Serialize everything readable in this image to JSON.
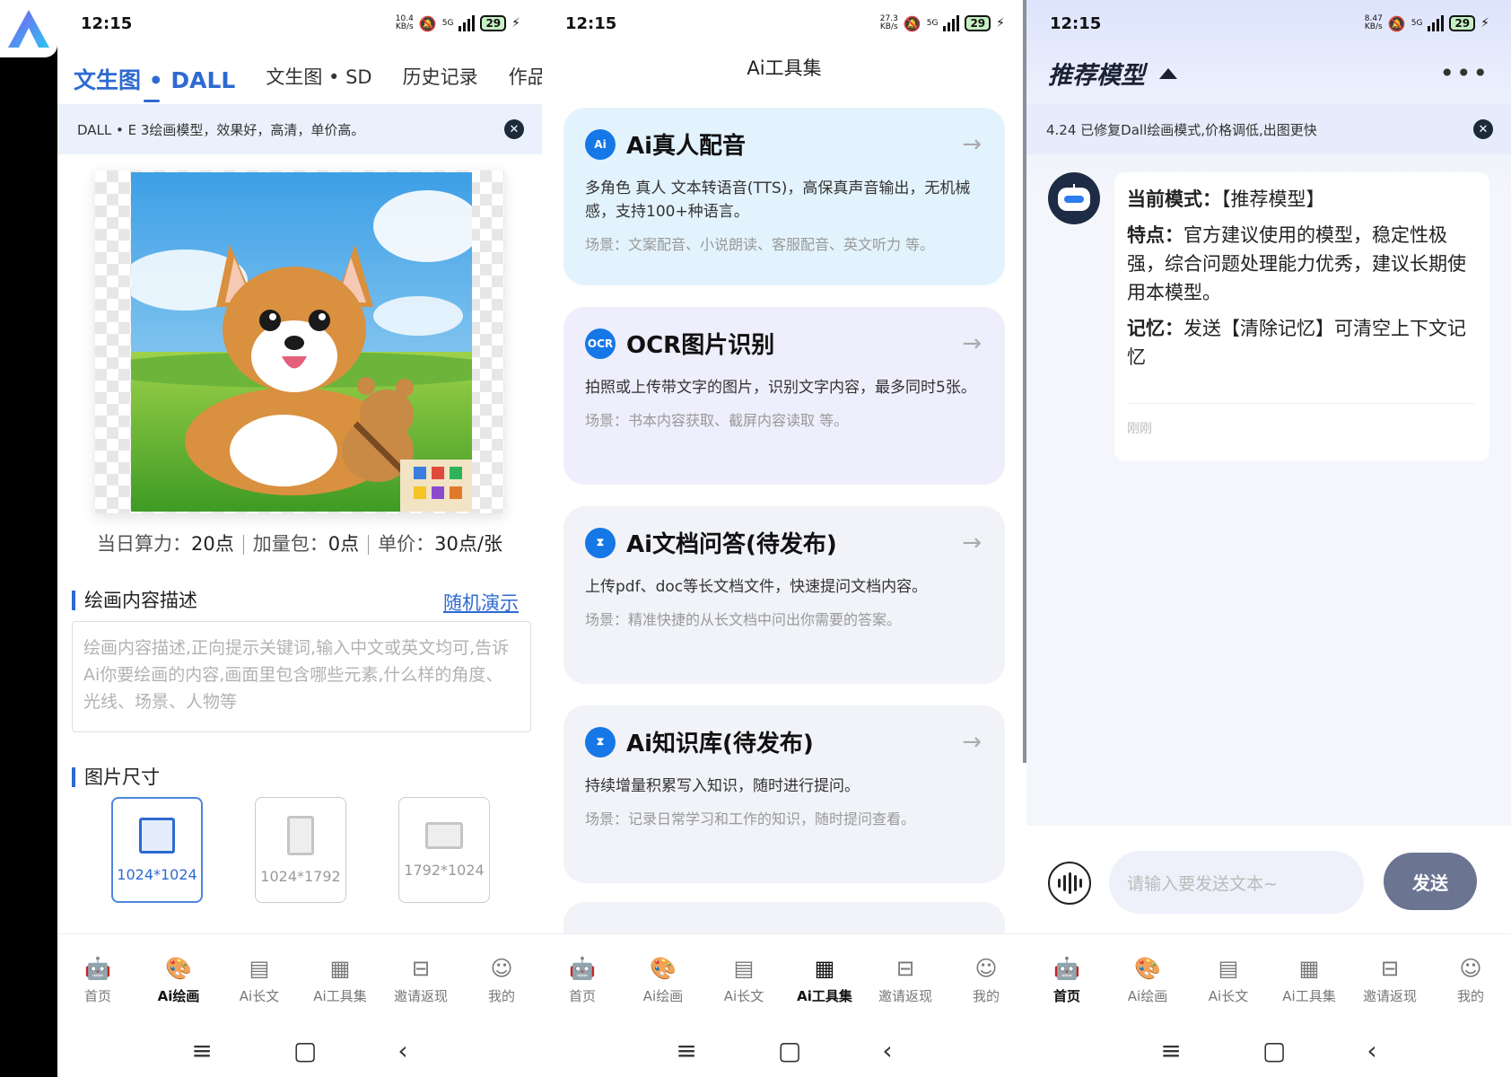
{
  "status": {
    "time": "12:15",
    "speed1": "10.4",
    "speed2": "27.3",
    "speed3": "8.47",
    "speed_unit": "KB/s",
    "network": "5G",
    "battery": "29"
  },
  "drawing": {
    "tabs": [
      "文生图 • DALL",
      "文生图 • SD",
      "历史记录",
      "作品广"
    ],
    "notice": "DALL • E 3绘画模型，效果好，高清，单价高。",
    "credits": {
      "daily_label": "当日算力：",
      "daily": "20点",
      "pack_label": "加量包：",
      "pack": "0点",
      "price_label": "单价：",
      "price": "30点/张"
    },
    "desc_title": "绘画内容描述",
    "random_demo": "随机演示",
    "desc_placeholder": "绘画内容描述,正向提示关键词,输入中文或英文均可,告诉Ai你要绘画的内容,画面里包含哪些元素,什么样的角度、光线、场景、人物等",
    "size_title": "图片尺寸",
    "sizes": [
      "1024*1024",
      "1024*1792",
      "1792*1024"
    ]
  },
  "tools": {
    "title": "Ai工具集",
    "cards": [
      {
        "name": "Ai真人配音",
        "icon": "Ai",
        "desc": "多角色 真人 文本转语音(TTS)，高保真声音输出，无机械感，支持100+种语言。",
        "scene": "场景：文案配音、小说朗读、客服配音、英文听力 等。",
        "bg": "#e3f3fd"
      },
      {
        "name": "OCR图片识别",
        "icon": "OCR",
        "desc": "拍照或上传带文字的图片，识别文字内容，最多同时5张。",
        "scene": "场景：书本内容获取、截屏内容读取 等。",
        "bg": "#eeeefc"
      },
      {
        "name": "Ai文档问答(待发布)",
        "icon": "⧗",
        "desc": "上传pdf、doc等长文档文件，快速提问文档内容。",
        "scene": "场景：精准快捷的从长文档中问出你需要的答案。",
        "bg": "#f1f3f8"
      },
      {
        "name": "Ai知识库(待发布)",
        "icon": "⧗",
        "desc": "持续增量积累写入知识，随时进行提问。",
        "scene": "场景：记录日常学习和工作的知识，随时提问查看。",
        "bg": "#f1f3f8"
      }
    ]
  },
  "chat": {
    "title": "推荐模型",
    "notice": "4.24 已修复Dall绘画模式,价格调低,出图更快",
    "mode_label": "当前模式：",
    "mode_value": "【推荐模型】",
    "feature_label": "特点：",
    "feature_value": "官方建议使用的模型，稳定性极强，综合问题处理能力优秀，建议长期使用本模型。",
    "memory_label": "记忆：",
    "memory_value": "发送【清除记忆】可清空上下文记忆",
    "time": "刚刚",
    "input_placeholder": "请输入要发送文本~",
    "send": "发送"
  },
  "nav": [
    "首页",
    "Ai绘画",
    "Ai长文",
    "Ai工具集",
    "邀请返现",
    "我的"
  ]
}
